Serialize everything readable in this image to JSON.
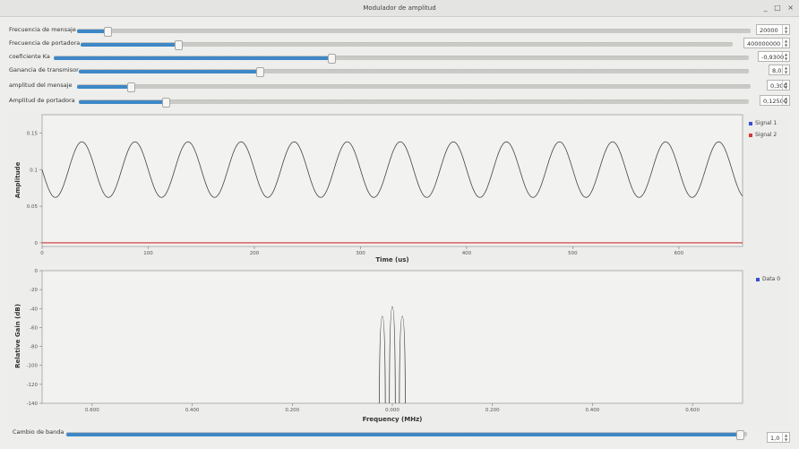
{
  "window": {
    "title": "Modulador de amplitud",
    "controls": [
      "_",
      "□",
      "×"
    ]
  },
  "controls": [
    {
      "label": "Frecuencia de mensaje",
      "value": "20000",
      "fill": 0.045
    },
    {
      "label": "Frecuencia de portadora",
      "value": "400000000",
      "fill": 0.15
    },
    {
      "label": "coeficiente Ka",
      "value": "-0,9300",
      "fill": 0.4
    },
    {
      "label": "Ganancia de transmisor",
      "value": "8,0",
      "fill": 0.27
    },
    {
      "label": "amplitud del mensaje",
      "value": "0,300",
      "fill": 0.08
    },
    {
      "label": "Amplitud de portadora",
      "value": "0,12500",
      "fill": 0.13
    }
  ],
  "time_plot": {
    "xlabel": "Time (us)",
    "ylabel": "Amplitude",
    "xticks": [
      "0",
      "100",
      "200",
      "300",
      "400",
      "500",
      "600"
    ],
    "yticks": [
      "0",
      "0.05",
      "0.1",
      "0.15"
    ],
    "legend": [
      {
        "name": "Signal 1",
        "color": "#3a4fd0"
      },
      {
        "name": "Signal 2",
        "color": "#d03a3a"
      }
    ]
  },
  "freq_plot": {
    "xlabel": "Frequency (MHz)",
    "ylabel": "Relative Gain (dB)",
    "xticks": [
      "0.600",
      "0.400",
      "0.200",
      "0.000",
      "0.200",
      "0.400",
      "0.600"
    ],
    "yticks": [
      "0",
      "-20",
      "-40",
      "-60",
      "-80",
      "-100",
      "-120",
      "-140"
    ],
    "legend": [
      {
        "name": "Data 0",
        "color": "#3a4fd0"
      }
    ]
  },
  "band": {
    "label": "Cambio de banda",
    "value": "1,0",
    "fill": 0.99
  },
  "chart_data": [
    {
      "type": "line",
      "xlabel": "Time (us)",
      "ylabel": "Amplitude",
      "xlim": [
        0,
        660
      ],
      "ylim": [
        -0.005,
        0.175
      ],
      "series": [
        {
          "name": "Signal 1",
          "kind": "sine",
          "offset": 0.1,
          "amplitude": 0.038,
          "period_us": 50,
          "x_range": [
            0,
            660
          ]
        },
        {
          "name": "Signal 2",
          "kind": "constant",
          "value": 0.0,
          "x_range": [
            0,
            660
          ]
        }
      ]
    },
    {
      "type": "line",
      "xlabel": "Frequency (MHz)",
      "ylabel": "Relative Gain (dB)",
      "xlim": [
        -0.7,
        0.7
      ],
      "ylim": [
        -140,
        0
      ],
      "series": [
        {
          "name": "Data 0",
          "peaks": [
            {
              "x": -0.02,
              "y": -48
            },
            {
              "x": 0.0,
              "y": -38
            },
            {
              "x": 0.02,
              "y": -48
            }
          ],
          "floor": -140
        }
      ]
    }
  ]
}
